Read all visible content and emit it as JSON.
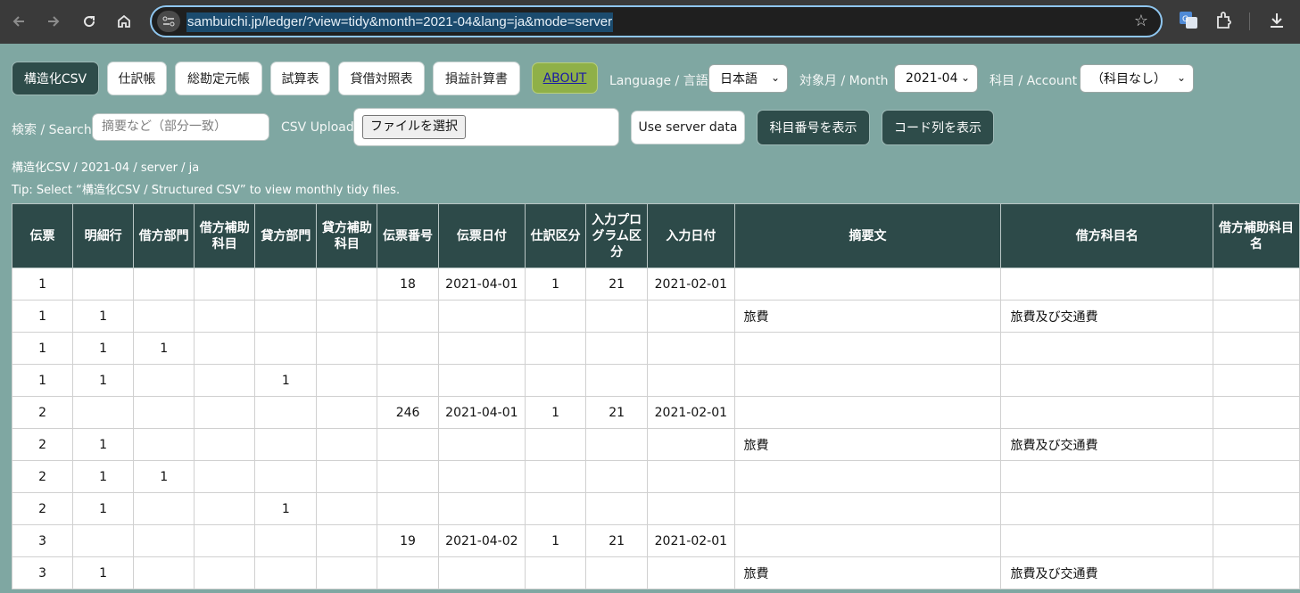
{
  "browser": {
    "url": "sambuichi.jp/ledger/?view=tidy&month=2021-04&lang=ja&mode=server",
    "icons": [
      "back-icon",
      "forward-icon",
      "reload-icon",
      "home-icon",
      "site-info-icon",
      "star-icon",
      "translate-icon",
      "extensions-icon",
      "download-icon"
    ]
  },
  "toolbar": {
    "tabs": [
      "構造化CSV",
      "仕訳帳",
      "総勘定元帳",
      "試算表",
      "貸借対照表",
      "損益計算書"
    ],
    "about": "ABOUT",
    "language_label": "Language / 言語",
    "language_value": "日本語",
    "month_label": "対象月 / Month",
    "month_value": "2021-04",
    "account_label": "科目 / Account",
    "account_value": "（科目なし）"
  },
  "search": {
    "label": "検索 / Search",
    "placeholder": "摘要など（部分一致）"
  },
  "upload": {
    "label": "CSV Upload",
    "file_button": "ファイルを選択"
  },
  "actions": {
    "use_server": "Use server data",
    "show_account_no": "科目番号を表示",
    "show_code_col": "コード列を表示"
  },
  "breadcrumb": "構造化CSV / 2021-04 / server / ja",
  "tip": "Tip: Select “構造化CSV / Structured CSV” to view monthly tidy files.",
  "colors": {
    "background": "#7fa7a2",
    "header_bg": "#2d4a49",
    "active_tab": "#2e4c4a",
    "about_bg": "#8fb048"
  },
  "table": {
    "headers": [
      "伝票",
      "明細行",
      "借方部門",
      "借方補助科目",
      "貸方部門",
      "貸方補助科目",
      "伝票番号",
      "伝票日付",
      "仕訳区分",
      "入力プログラム区分",
      "入力日付",
      "摘要文",
      "借方科目名",
      "借方補助科目名"
    ],
    "rows": [
      [
        "1",
        "",
        "",
        "",
        "",
        "",
        "18",
        "2021-04-01",
        "1",
        "21",
        "2021-02-01",
        "",
        "",
        ""
      ],
      [
        "1",
        "1",
        "",
        "",
        "",
        "",
        "",
        "",
        "",
        "",
        "",
        "旅費",
        "旅費及び交通費",
        ""
      ],
      [
        "1",
        "1",
        "1",
        "",
        "",
        "",
        "",
        "",
        "",
        "",
        "",
        "",
        "",
        ""
      ],
      [
        "1",
        "1",
        "",
        "",
        "1",
        "",
        "",
        "",
        "",
        "",
        "",
        "",
        "",
        ""
      ],
      [
        "2",
        "",
        "",
        "",
        "",
        "",
        "246",
        "2021-04-01",
        "1",
        "21",
        "2021-02-01",
        "",
        "",
        ""
      ],
      [
        "2",
        "1",
        "",
        "",
        "",
        "",
        "",
        "",
        "",
        "",
        "",
        "旅費",
        "旅費及び交通費",
        ""
      ],
      [
        "2",
        "1",
        "1",
        "",
        "",
        "",
        "",
        "",
        "",
        "",
        "",
        "",
        "",
        ""
      ],
      [
        "2",
        "1",
        "",
        "",
        "1",
        "",
        "",
        "",
        "",
        "",
        "",
        "",
        "",
        ""
      ],
      [
        "3",
        "",
        "",
        "",
        "",
        "",
        "19",
        "2021-04-02",
        "1",
        "21",
        "2021-02-01",
        "",
        "",
        ""
      ],
      [
        "3",
        "1",
        "",
        "",
        "",
        "",
        "",
        "",
        "",
        "",
        "",
        "旅費",
        "旅費及び交通費",
        ""
      ]
    ]
  }
}
